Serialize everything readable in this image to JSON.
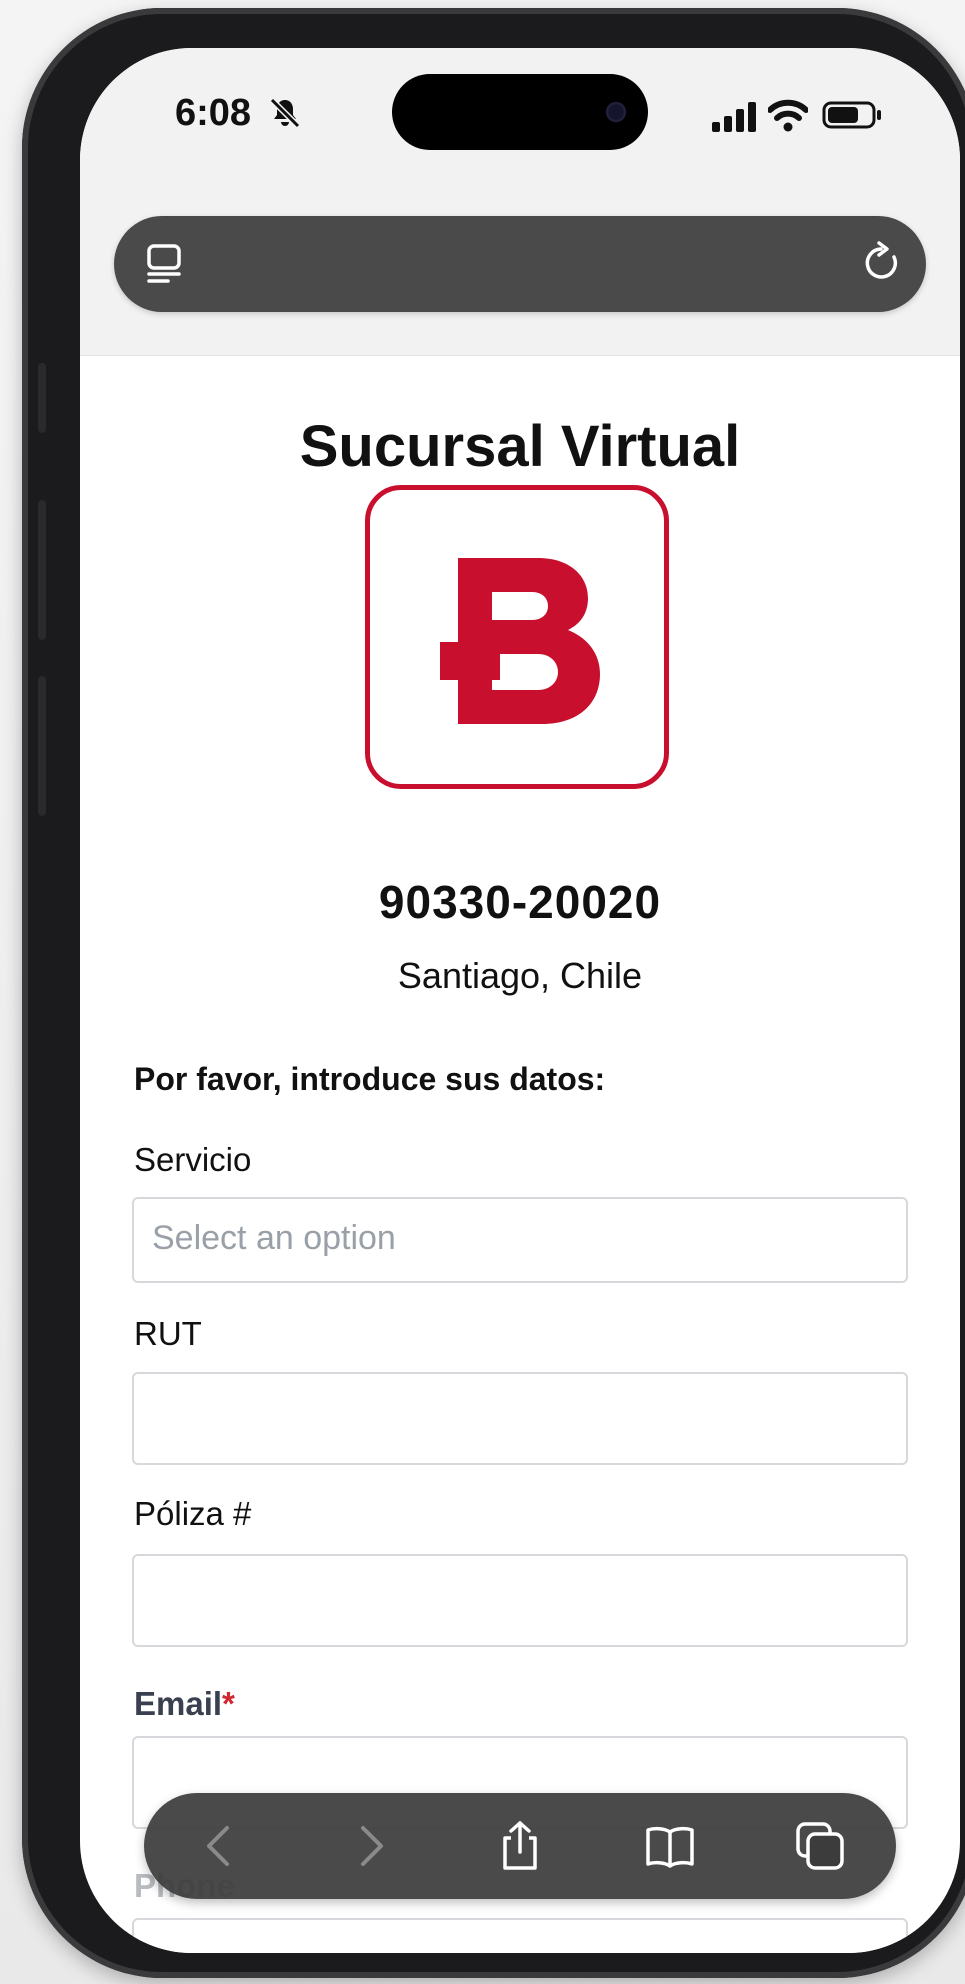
{
  "status": {
    "time": "6:08"
  },
  "page": {
    "title": "Sucursal Virtual",
    "phone": "90330-20020",
    "location": "Santiago, Chile",
    "prompt": "Por favor, introduce sus datos:"
  },
  "form": {
    "servicio": {
      "label": "Servicio",
      "placeholder": "Select an option"
    },
    "rut": {
      "label": "RUT",
      "value": ""
    },
    "poliza": {
      "label": "Póliza #",
      "value": ""
    },
    "email": {
      "label": "Email",
      "required_mark": "*",
      "value": ""
    },
    "phone": {
      "label": "Phone",
      "value": ""
    }
  },
  "colors": {
    "brand": "#c8102e",
    "required": "#d22630"
  },
  "icons": {
    "urlbar": [
      "tabs-icon",
      "reload-icon"
    ],
    "toolbar": [
      "back-icon",
      "forward-icon",
      "share-icon",
      "bookmarks-icon",
      "tabs-overview-icon"
    ]
  }
}
